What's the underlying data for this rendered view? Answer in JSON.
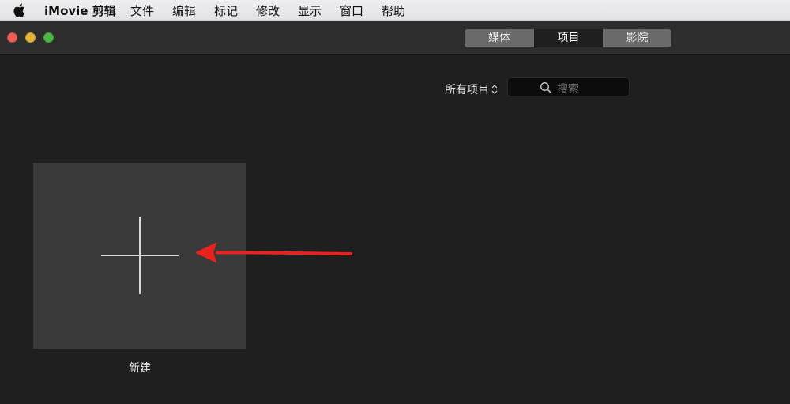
{
  "menubar": {
    "app_name": "iMovie 剪辑",
    "items": [
      "文件",
      "编辑",
      "标记",
      "修改",
      "显示",
      "窗口",
      "帮助"
    ]
  },
  "window": {
    "segments": {
      "media": "媒体",
      "projects": "项目",
      "theater": "影院",
      "selected": "项目"
    },
    "filter_label": "所有项目",
    "search": {
      "placeholder": "搜索"
    }
  },
  "projects": {
    "new_tile_label": "新建"
  },
  "colors": {
    "background": "#1f1f1f",
    "tile": "#3a3a3a",
    "annotation_arrow": "#e8231e"
  },
  "icons": {
    "apple": "apple-icon",
    "search": "magnifier-icon",
    "filter": "updown-chevron-icon",
    "new": "plus-icon",
    "annotation": "red-arrow"
  }
}
